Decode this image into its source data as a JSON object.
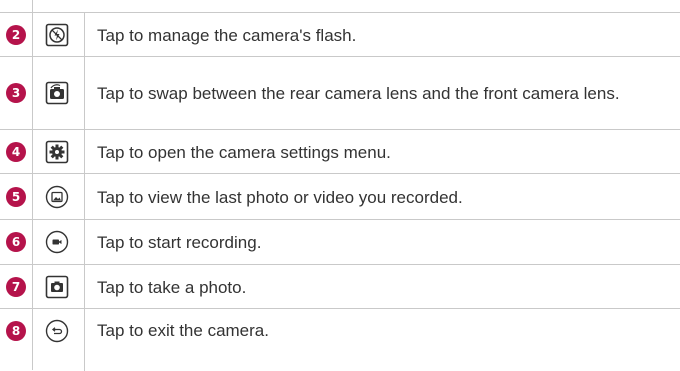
{
  "rows": [
    {
      "num": "2",
      "icon": "flash-off-icon",
      "text": "Tap to manage the camera's flash."
    },
    {
      "num": "3",
      "icon": "swap-camera-icon",
      "text": "Tap to swap between the rear camera lens and the front camera lens."
    },
    {
      "num": "4",
      "icon": "gear-icon",
      "text": "Tap to open the camera settings menu."
    },
    {
      "num": "5",
      "icon": "gallery-icon",
      "text": "Tap to view the last photo or video you recorded."
    },
    {
      "num": "6",
      "icon": "record-video-icon",
      "text": "Tap to start recording."
    },
    {
      "num": "7",
      "icon": "camera-shutter-icon",
      "text": "Tap to take a photo."
    },
    {
      "num": "8",
      "icon": "back-exit-icon",
      "text": "Tap to exit the camera."
    }
  ],
  "colors": {
    "badge": "#b5134b",
    "rule": "#c9c9c9",
    "icon": "#333333"
  }
}
